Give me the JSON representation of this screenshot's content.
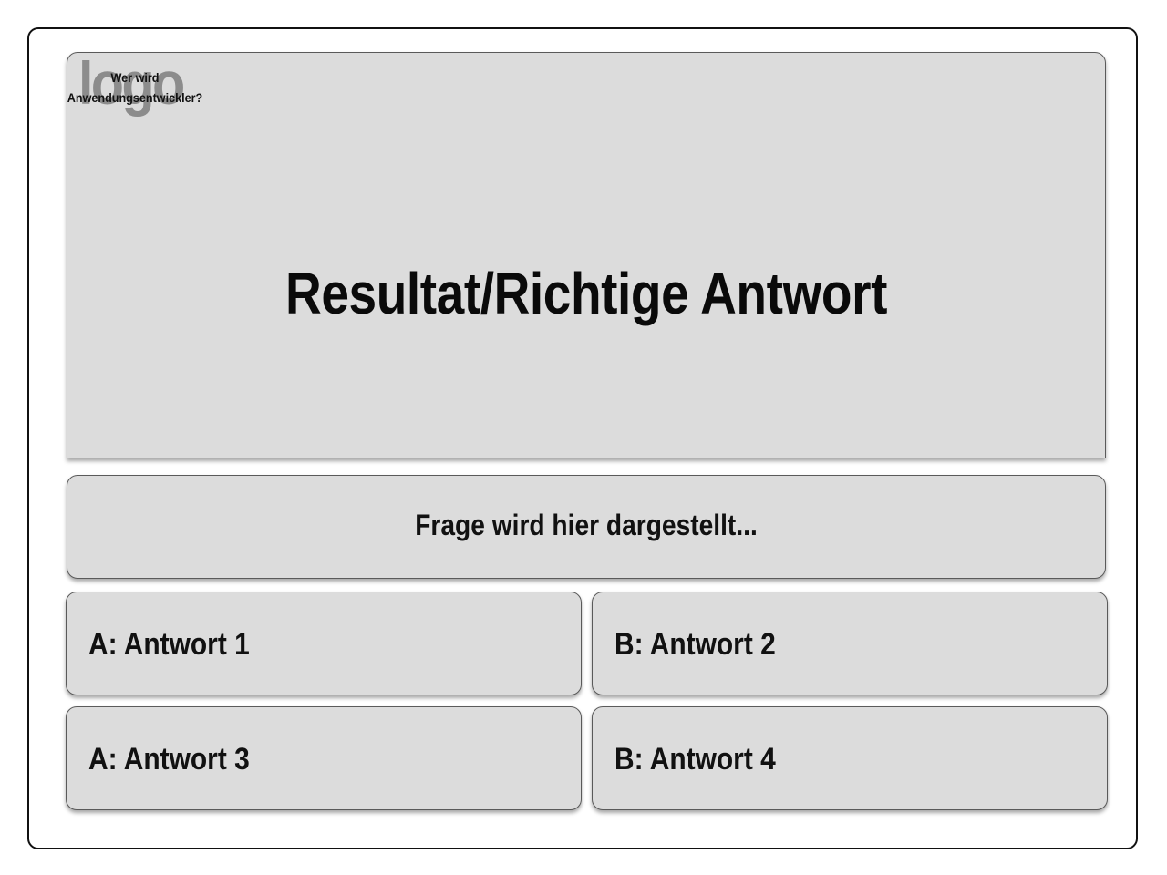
{
  "logo": {
    "image_word": "logo",
    "caption_line1": "Wer wird",
    "caption_line2": "Anwendungsentwickler?"
  },
  "result": {
    "title": "Resultat/Richtige Antwort"
  },
  "question": {
    "text": "Frage wird hier dargestellt..."
  },
  "answers": [
    {
      "label": "A: Antwort 1"
    },
    {
      "label": "B: Antwort 2"
    },
    {
      "label": "A: Antwort 3"
    },
    {
      "label": "B: Antwort 4"
    }
  ],
  "colors": {
    "panel_background": "#dcdcdc",
    "panel_border": "#5a5a5a",
    "frame_border": "#111111",
    "logo_gray": "#8c8c8c"
  }
}
